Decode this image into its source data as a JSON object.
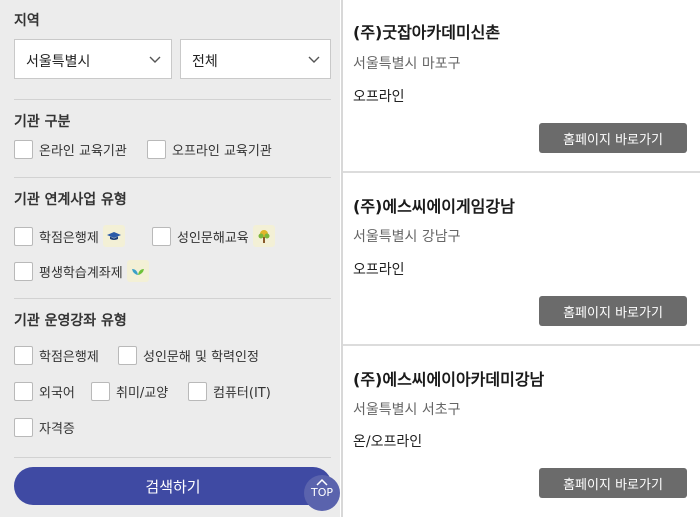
{
  "filters": {
    "region_label": "지역",
    "region_select": "서울특별시",
    "district_select": "전체",
    "org_type_label": "기관 구분",
    "org_type_options": [
      "온라인 교육기관",
      "오프라인 교육기관"
    ],
    "linked_label": "기관 연계사업 유형",
    "linked_options": [
      "학점은행제",
      "성인문해교육",
      "평생학습계좌제"
    ],
    "course_label": "기관 운영강좌 유형",
    "course_options": [
      "학점은행제",
      "성인문해 및 학력인정",
      "외국어",
      "취미/교양",
      "컴퓨터(IT)",
      "자격증"
    ],
    "search_button": "검색하기",
    "top_button": "TOP"
  },
  "results": [
    {
      "name": "(주)굿잡아카데미신촌",
      "address": "서울특별시 마포구",
      "mode": "오프라인",
      "homepage": "홈페이지 바로가기"
    },
    {
      "name": "(주)에스씨에이게임강남",
      "address": "서울특별시 강남구",
      "mode": "오프라인",
      "homepage": "홈페이지 바로가기"
    },
    {
      "name": "(주)에스씨에이아카데미강남",
      "address": "서울특별시 서초구",
      "mode": "온/오프라인",
      "homepage": "홈페이지 바로가기"
    }
  ],
  "icons": {
    "chevron": "chevron-down-icon",
    "credit_bank_badge": "graduation-cap-icon",
    "literacy_badge": "tree-icon",
    "lifelong_badge": "sprout-icon",
    "top_arrow": "chevron-up-icon"
  },
  "colors": {
    "panel_bg": "#ececec",
    "search_button": "#3f4aa3",
    "homepage_button": "#6b6b6b"
  }
}
